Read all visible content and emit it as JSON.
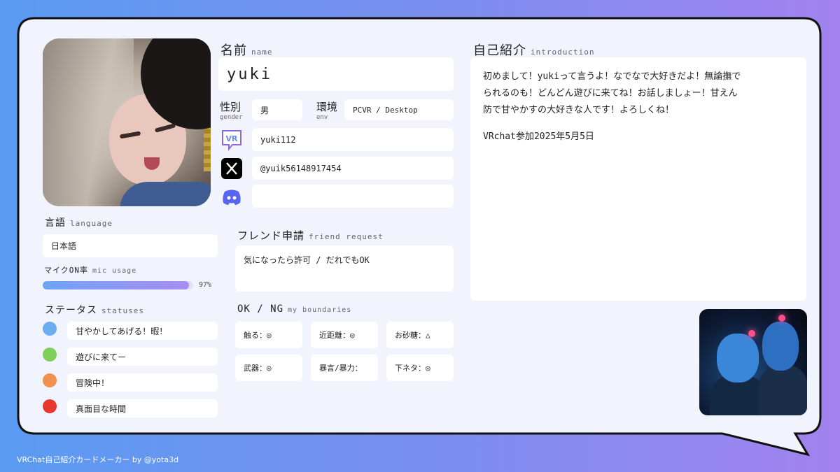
{
  "colors": {
    "bg_left": "#5a9bf2",
    "bg_right": "#a282ef",
    "card": "#f1f3fd",
    "box": "#ffffff",
    "bar_start": "#6ea4f3",
    "bar_end": "#a98ef0",
    "discord": "#5865f2"
  },
  "profile": {
    "name_label": "名前",
    "name_sub": "name",
    "name": "yuki",
    "gender_label": "性別",
    "gender_sub": "gender",
    "gender": "男",
    "env_label": "環境",
    "env_sub": "env",
    "env": "PCVR / Desktop",
    "vrchat_id": "yuki112",
    "x_handle": "@yuik56148917454",
    "discord": "",
    "icons": {
      "vrchat": "vr-chat-bubble-icon",
      "x": "x-logo-icon",
      "discord": "discord-icon"
    }
  },
  "language": {
    "label": "言語",
    "sub": "language",
    "value": "日本語"
  },
  "mic": {
    "label": "マイクON率",
    "sub": "mic usage",
    "percent_text": "97%",
    "percent": 97
  },
  "statuses": {
    "label": "ステータス",
    "sub": "statuses",
    "items": [
      {
        "color": "#6aaef0",
        "text": "甘やかしてあげる！暇！"
      },
      {
        "color": "#7fcf5a",
        "text": "遊びに来てー"
      },
      {
        "color": "#f0914f",
        "text": "冒険中！"
      },
      {
        "color": "#e8372f",
        "text": "真面目な時間"
      }
    ]
  },
  "friend": {
    "label": "フレンド申請",
    "sub": "friend request",
    "value": "気になったら許可 / だれでもOK"
  },
  "boundaries": {
    "label": "OK / NG",
    "sub": "my boundaries",
    "items": [
      "触る：◎",
      "近距離：◎",
      "お砂糖：△",
      "武器：◎",
      "暴言/暴力：",
      "下ネタ：◎"
    ]
  },
  "intro": {
    "label": "自己紹介",
    "sub": "introduction",
    "lines": [
      "初めまして！yukiって言うよ！なでなで大好きだよ！無論撫で",
      "られるのも！どんどん遊びに来てね！お話しましょー！甘えん",
      "防で甘やかすの大好きな人です！よろしくね！"
    ],
    "joined": "VRchat参加2025年5月5日"
  },
  "footer": "VRChat自己紹介カードメーカー by @yota3d"
}
